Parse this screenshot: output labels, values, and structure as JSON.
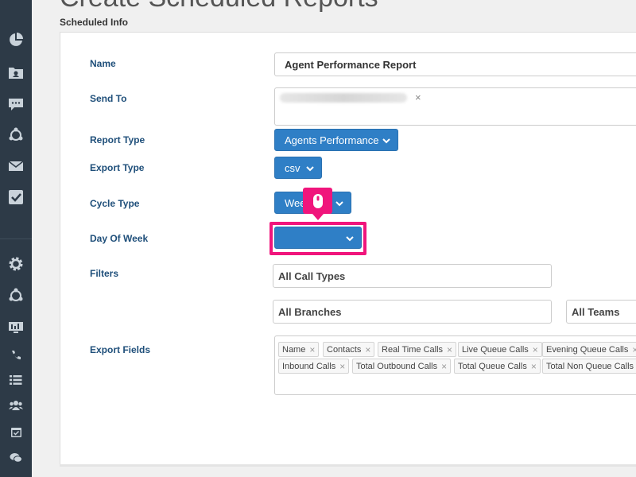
{
  "page": {
    "title": "Create Scheduled Reports",
    "section": "Scheduled Info"
  },
  "sidebar": {
    "icons": [
      "pie-chart-icon",
      "contacts-folder-icon",
      "chat-icon",
      "integrations-icon",
      "mail-icon",
      "checklist-icon",
      "settings-gear-icon",
      "network-icon",
      "monitor-icon",
      "phone-icon",
      "list-icon",
      "users-icon",
      "calendar-icon",
      "conversations-icon"
    ]
  },
  "form": {
    "name": {
      "label": "Name",
      "value": "Agent Performance Report"
    },
    "send_to": {
      "label": "Send To",
      "remove": "×"
    },
    "report_type": {
      "label": "Report Type",
      "value": "Agents Performance"
    },
    "export_type": {
      "label": "Export Type",
      "value": "csv"
    },
    "cycle_type": {
      "label": "Cycle Type",
      "value": "Wee"
    },
    "day_of_week": {
      "label": "Day Of Week",
      "value": ""
    },
    "filters": {
      "label": "Filters",
      "call_types": "All Call Types",
      "branches": "All Branches",
      "teams": "All Teams"
    },
    "export_fields": {
      "label": "Export Fields",
      "tags": [
        "Name",
        "Contacts",
        "Real Time Calls",
        "Live Queue Calls",
        "Evening Queue Calls",
        "Inbound Calls",
        "Total Outbound Calls",
        "Total Queue Calls",
        "Total Non Queue Calls"
      ],
      "remove": "×"
    }
  },
  "colors": {
    "accent": "#2f7fc6",
    "highlight": "#f0157c",
    "sidebar": "#2d3a47",
    "label": "#1f4f7a"
  }
}
